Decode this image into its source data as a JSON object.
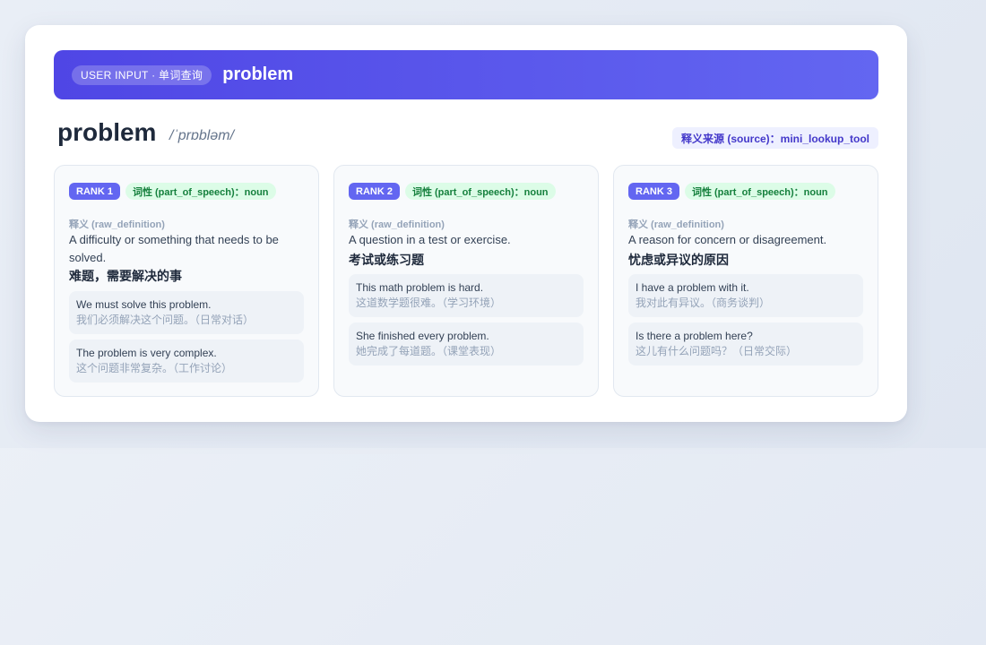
{
  "banner": {
    "tag": "USER INPUT · 单词查询",
    "word": "problem"
  },
  "header": {
    "word": "problem",
    "phonetic": "/ˈprɒbləm/",
    "source": "释义来源 (source)：mini_lookup_tool"
  },
  "definition_label": "释义 (raw_definition)",
  "senses": [
    {
      "rank": "RANK 1",
      "pos": "词性 (part_of_speech)：noun",
      "definition_en": "A difficulty or something that needs to be solved.",
      "definition_zh": "难题，需要解决的事",
      "examples": [
        {
          "en": "We must solve this problem.",
          "zh": "我们必须解决这个问题。（日常对话）"
        },
        {
          "en": "The problem is very complex.",
          "zh": "这个问题非常复杂。（工作讨论）"
        }
      ]
    },
    {
      "rank": "RANK 2",
      "pos": "词性 (part_of_speech)：noun",
      "definition_en": "A question in a test or exercise.",
      "definition_zh": "考试或练习题",
      "examples": [
        {
          "en": "This math problem is hard.",
          "zh": "这道数学题很难。（学习环境）"
        },
        {
          "en": "She finished every problem.",
          "zh": "她完成了每道题。（课堂表现）"
        }
      ]
    },
    {
      "rank": "RANK 3",
      "pos": "词性 (part_of_speech)：noun",
      "definition_en": "A reason for concern or disagreement.",
      "definition_zh": "忧虑或异议的原因",
      "examples": [
        {
          "en": "I have a problem with it.",
          "zh": "我对此有异议。（商务谈判）"
        },
        {
          "en": "Is there a problem here?",
          "zh": "这儿有什么问题吗？（日常交际）"
        }
      ]
    }
  ]
}
